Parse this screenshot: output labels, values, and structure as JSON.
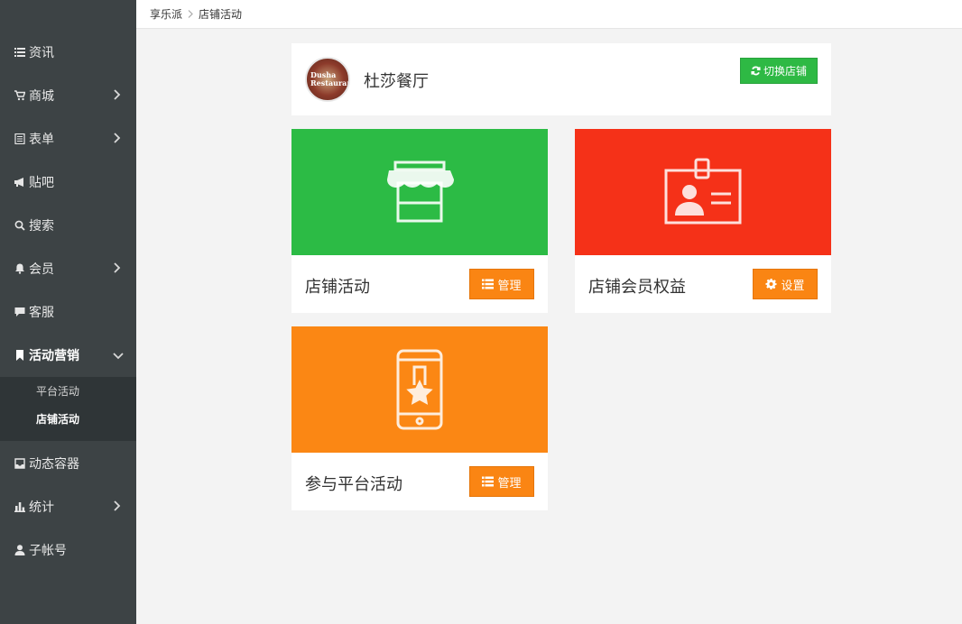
{
  "sidebar": {
    "items": [
      {
        "label": "资讯",
        "icon": "list-icon"
      },
      {
        "label": "商城",
        "icon": "cart-icon"
      },
      {
        "label": "表单",
        "icon": "form-icon"
      },
      {
        "label": "贴吧",
        "icon": "megaphone-icon"
      },
      {
        "label": "搜索",
        "icon": "search-icon"
      },
      {
        "label": "会员",
        "icon": "bell-icon"
      },
      {
        "label": "客服",
        "icon": "chat-icon"
      },
      {
        "label": "活动营销",
        "icon": "bookmark-icon"
      },
      {
        "label": "动态容器",
        "icon": "inbox-icon"
      },
      {
        "label": "统计",
        "icon": "bar-chart-icon"
      },
      {
        "label": "子帐号",
        "icon": "user-icon"
      }
    ],
    "submenu": [
      {
        "label": "平台活动"
      },
      {
        "label": "店铺活动"
      }
    ]
  },
  "breadcrumb": {
    "root": "享乐派",
    "current": "店铺活动"
  },
  "store": {
    "name": "杜莎餐厅",
    "avatar_text": "Dusha Restaurant",
    "switch_label": "切换店铺"
  },
  "cards": [
    {
      "title": "店铺活动",
      "button": "管理",
      "color": "#2cbb45",
      "icon": "storefront-icon"
    },
    {
      "title": "店铺会员权益",
      "button": "设置",
      "color": "#f53118",
      "icon": "member-badge-icon"
    },
    {
      "title": "参与平台活动",
      "button": "管理",
      "color": "#fb8714",
      "icon": "phone-star-icon"
    }
  ]
}
